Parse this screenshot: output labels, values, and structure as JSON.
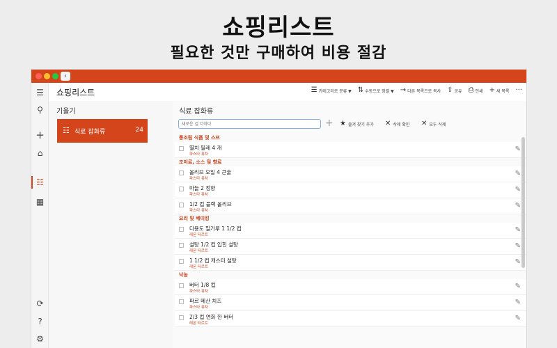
{
  "headline": {
    "title": "쇼핑리스트",
    "subtitle": "필요한 것만 구매하여 비용 절감"
  },
  "app": {
    "page_title": "쇼핑리스트"
  },
  "toolbar": {
    "category_sort": "카테고리로 분류 ▼",
    "manual_sort": "수동으로 정렬 ▼",
    "copy_to_list": "다른 목록으로 복사",
    "share": "공유",
    "print": "인쇄",
    "new_item": "새 목록",
    "more": "···"
  },
  "sidebar": {
    "heading": "기울기",
    "items": [
      {
        "label": "식료 잡화류",
        "count": "24"
      }
    ]
  },
  "main": {
    "heading": "식료 잡화류",
    "input_placeholder": "새로운 걸 더하다",
    "add_favorites": "즐겨 찾기 추가",
    "delete_checked": "삭제 확인",
    "delete_all": "모두 삭제"
  },
  "categories": [
    {
      "name": "통조림 식품 및 스프",
      "items": [
        {
          "name": "멸치 필레 4 개",
          "source": "파스타 퓨차"
        }
      ]
    },
    {
      "name": "조미료, 소스 및 향료",
      "items": [
        {
          "name": "올리브 오일 4 큰술",
          "source": "파스타 퓨차"
        },
        {
          "name": "마늘 2 정향",
          "source": "파스타 퓨차"
        },
        {
          "name": "1/2 컵 블랙 올리브",
          "source": "파스타 퓨차"
        }
      ]
    },
    {
      "name": "요리 및 베이킹",
      "items": [
        {
          "name": "다용도 밀가루 1 1/2 컵",
          "source": "레몬 타르트"
        },
        {
          "name": "설탕 1/2 컵 입힌 설탕",
          "source": "레몬 타르트"
        },
        {
          "name": "1 1/2 컵 캐스터 설탕",
          "source": "레몬 타르트"
        }
      ]
    },
    {
      "name": "낙농",
      "items": [
        {
          "name": "버터 1/8 컵",
          "source": "파스타 퓨차"
        },
        {
          "name": "파르 메산 치즈",
          "source": "파스타 퓨차"
        },
        {
          "name": "2/3 컵 연화 한 버터",
          "source": "레몬 타르트"
        }
      ]
    }
  ],
  "icons": {
    "menu": "hamburger-icon",
    "search": "search-icon",
    "add": "plus-icon",
    "home": "home-icon",
    "list": "list-icon",
    "calendar": "calendar-icon",
    "sync": "sync-icon",
    "help": "help-icon",
    "settings": "gear-icon"
  },
  "colors": {
    "accent": "#d4451c",
    "category_text": "#c8431d"
  }
}
